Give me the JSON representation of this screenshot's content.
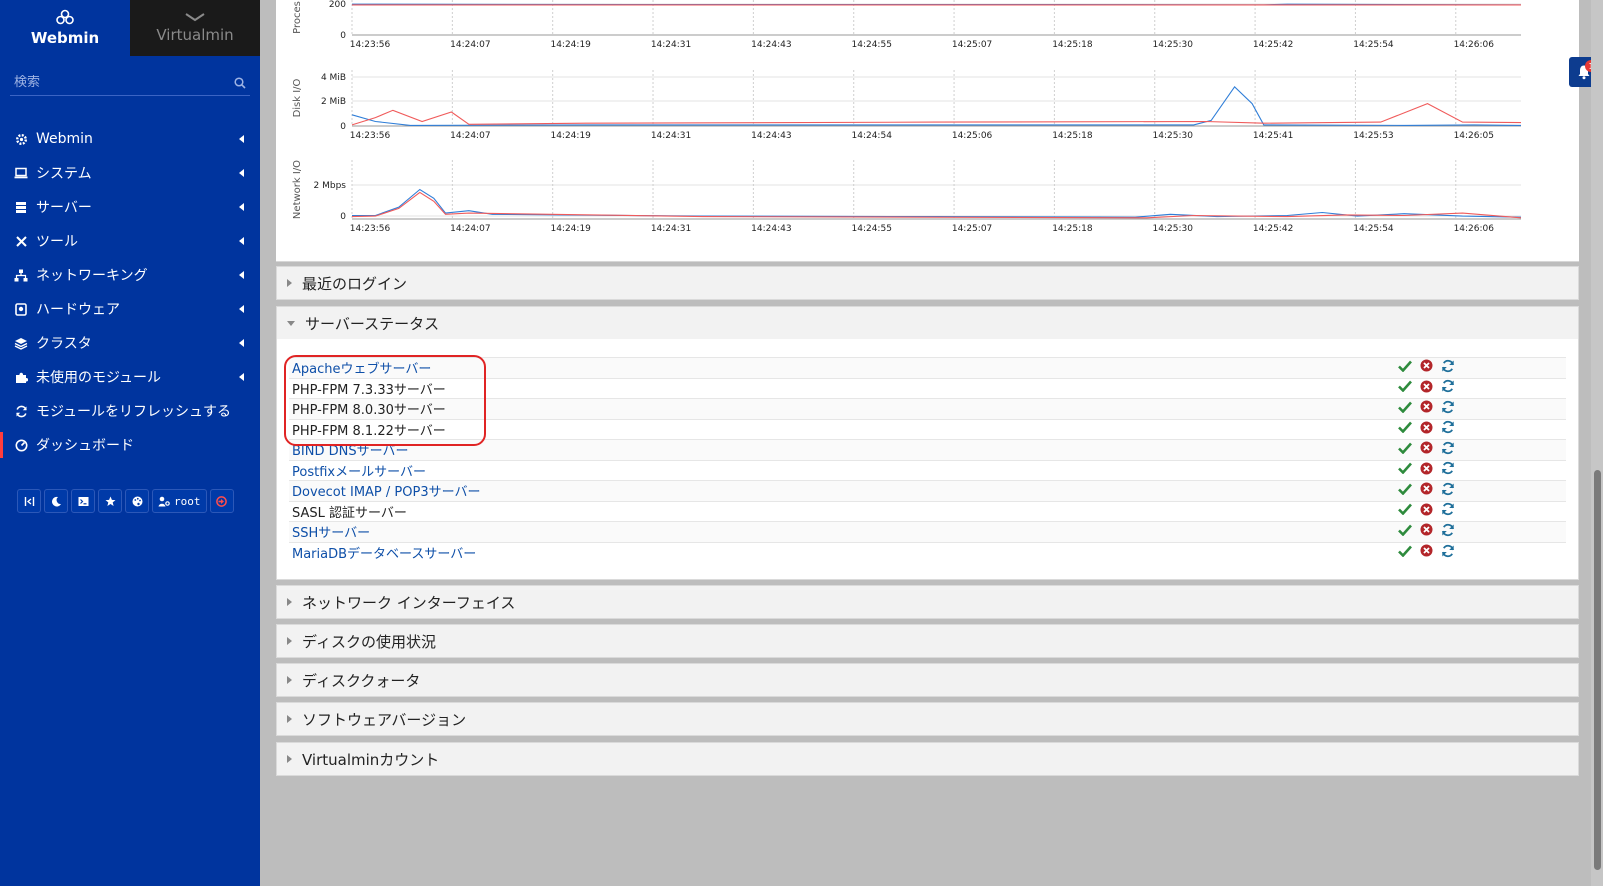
{
  "sidebar": {
    "tabs": [
      {
        "label": "Webmin"
      },
      {
        "label": "Virtualmin"
      }
    ],
    "search_placeholder": "検索",
    "items": [
      {
        "label": "Webmin",
        "icon": "gear-icon"
      },
      {
        "label": "システム",
        "icon": "laptop-icon"
      },
      {
        "label": "サーバー",
        "icon": "server-icon"
      },
      {
        "label": "ツール",
        "icon": "tools-icon"
      },
      {
        "label": "ネットワーキング",
        "icon": "network-icon"
      },
      {
        "label": "ハードウェア",
        "icon": "hdd-icon"
      },
      {
        "label": "クラスタ",
        "icon": "layers-icon"
      },
      {
        "label": "未使用のモジュール",
        "icon": "puzzle-icon"
      },
      {
        "label": "モジュールをリフレッシュする",
        "icon": "refresh-icon"
      },
      {
        "label": "ダッシュボード",
        "icon": "dashboard-icon"
      }
    ],
    "toolbar": {
      "user": "root"
    }
  },
  "notifications": {
    "count": "1"
  },
  "charts": {
    "proc": {
      "ylabel": "Proces",
      "yticks": [
        "200",
        "0"
      ],
      "xticks": [
        "14:23:56",
        "14:24:07",
        "14:24:19",
        "14:24:31",
        "14:24:43",
        "14:24:55",
        "14:25:07",
        "14:25:18",
        "14:25:30",
        "14:25:42",
        "14:25:54",
        "14:26:06"
      ]
    },
    "disk": {
      "ylabel": "Disk I/O",
      "yticks": [
        "4 MiB",
        "2 MiB",
        "0"
      ],
      "xticks": [
        "14:23:56",
        "14:24:07",
        "14:24:19",
        "14:24:31",
        "14:24:43",
        "14:24:54",
        "14:25:06",
        "14:25:18",
        "14:25:30",
        "14:25:41",
        "14:25:53",
        "14:26:05"
      ]
    },
    "net": {
      "ylabel": "Network I/O",
      "yticks": [
        "2 Mbps",
        "0"
      ],
      "xticks": [
        "14:23:56",
        "14:24:07",
        "14:24:19",
        "14:24:31",
        "14:24:43",
        "14:24:55",
        "14:25:07",
        "14:25:18",
        "14:25:30",
        "14:25:42",
        "14:25:54",
        "14:26:06"
      ]
    },
    "colors": {
      "series_a": "#2f7ed8",
      "series_b": "#f05b5b"
    }
  },
  "panels": {
    "recent_logins": "最近のログイン",
    "server_status": "サーバーステータス",
    "network_interfaces": "ネットワーク インターフェイス",
    "disk_usage": "ディスクの使用状況",
    "disk_quota": "ディスククォータ",
    "software_versions": "ソフトウェアバージョン",
    "virtualmin_accounts": "Virtualminカウント"
  },
  "servers": [
    {
      "name": "Apacheウェブサーバー",
      "link": true
    },
    {
      "name": "PHP-FPM 7.3.33サーバー",
      "link": false
    },
    {
      "name": "PHP-FPM 8.0.30サーバー",
      "link": false
    },
    {
      "name": "PHP-FPM 8.1.22サーバー",
      "link": false
    },
    {
      "name": "BIND DNSサーバー",
      "link": true
    },
    {
      "name": "Postfixメールサーバー",
      "link": true
    },
    {
      "name": "Dovecot IMAP / POP3サーバー",
      "link": true
    },
    {
      "name": "SASL 認証サーバー",
      "link": false
    },
    {
      "name": "SSHサーバー",
      "link": true
    },
    {
      "name": "MariaDBデータベースサーバー",
      "link": true
    }
  ]
}
